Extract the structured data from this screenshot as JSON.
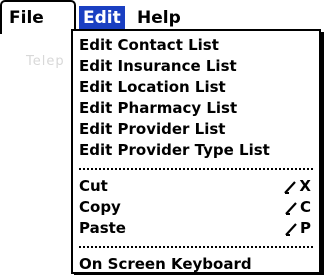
{
  "background_hint": "Telep",
  "menubar": {
    "file_label": "File",
    "edit_label": "Edit",
    "help_label": "Help",
    "selected_color": "#1a3fc2"
  },
  "dropdown": {
    "group1": [
      {
        "label": "Edit Contact List"
      },
      {
        "label": "Edit Insurance List"
      },
      {
        "label": "Edit Location List"
      },
      {
        "label": "Edit Pharmacy List"
      },
      {
        "label": "Edit Provider List"
      },
      {
        "label": "Edit Provider Type List"
      }
    ],
    "group2": [
      {
        "label": "Cut",
        "shortcut": "X",
        "shortcut_icon": "command-stroke-icon"
      },
      {
        "label": "Copy",
        "shortcut": "C",
        "shortcut_icon": "command-stroke-icon"
      },
      {
        "label": "Paste",
        "shortcut": "P",
        "shortcut_icon": "command-stroke-icon"
      }
    ],
    "group3": [
      {
        "label": "On Screen Keyboard"
      }
    ]
  }
}
